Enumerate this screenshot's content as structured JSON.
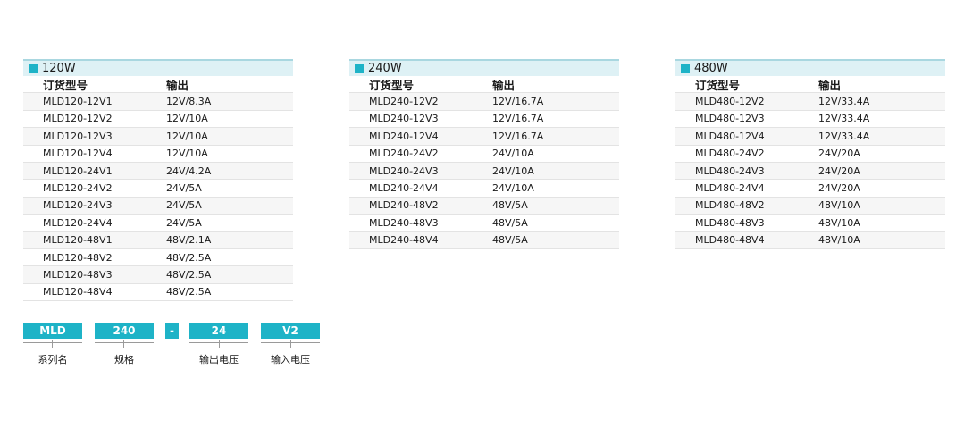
{
  "tables": [
    {
      "title": "120W",
      "headers": [
        "订货型号",
        "输出"
      ],
      "rows": [
        [
          "MLD120-12V1",
          "12V/8.3A"
        ],
        [
          "MLD120-12V2",
          "12V/10A"
        ],
        [
          "MLD120-12V3",
          "12V/10A"
        ],
        [
          "MLD120-12V4",
          "12V/10A"
        ],
        [
          "MLD120-24V1",
          "24V/4.2A"
        ],
        [
          "MLD120-24V2",
          "24V/5A"
        ],
        [
          "MLD120-24V3",
          "24V/5A"
        ],
        [
          "MLD120-24V4",
          "24V/5A"
        ],
        [
          "MLD120-48V1",
          "48V/2.1A"
        ],
        [
          "MLD120-48V2",
          "48V/2.5A"
        ],
        [
          "MLD120-48V3",
          "48V/2.5A"
        ],
        [
          "MLD120-48V4",
          "48V/2.5A"
        ]
      ]
    },
    {
      "title": "240W",
      "headers": [
        "订货型号",
        "输出"
      ],
      "rows": [
        [
          "MLD240-12V2",
          "12V/16.7A"
        ],
        [
          "MLD240-12V3",
          "12V/16.7A"
        ],
        [
          "MLD240-12V4",
          "12V/16.7A"
        ],
        [
          "MLD240-24V2",
          "24V/10A"
        ],
        [
          "MLD240-24V3",
          "24V/10A"
        ],
        [
          "MLD240-24V4",
          "24V/10A"
        ],
        [
          "MLD240-48V2",
          "48V/5A"
        ],
        [
          "MLD240-48V3",
          "48V/5A"
        ],
        [
          "MLD240-48V4",
          "48V/5A"
        ]
      ]
    },
    {
      "title": "480W",
      "headers": [
        "订货型号",
        "输出"
      ],
      "rows": [
        [
          "MLD480-12V2",
          "12V/33.4A"
        ],
        [
          "MLD480-12V3",
          "12V/33.4A"
        ],
        [
          "MLD480-12V4",
          "12V/33.4A"
        ],
        [
          "MLD480-24V2",
          "24V/20A"
        ],
        [
          "MLD480-24V3",
          "24V/20A"
        ],
        [
          "MLD480-24V4",
          "24V/20A"
        ],
        [
          "MLD480-48V2",
          "48V/10A"
        ],
        [
          "MLD480-48V3",
          "48V/10A"
        ],
        [
          "MLD480-48V4",
          "48V/10A"
        ]
      ]
    }
  ],
  "code": {
    "parts": [
      {
        "value": "MLD",
        "label": "系列名"
      },
      {
        "value": "240",
        "label": "规格"
      },
      {
        "value": "-",
        "label": ""
      },
      {
        "value": "24",
        "label": "输出电压"
      },
      {
        "value": "V2",
        "label": "输入电压"
      }
    ]
  },
  "colors": {
    "accent": "#1eb3c7",
    "header_bg": "#def1f5",
    "stripe": "#f6f6f6"
  }
}
